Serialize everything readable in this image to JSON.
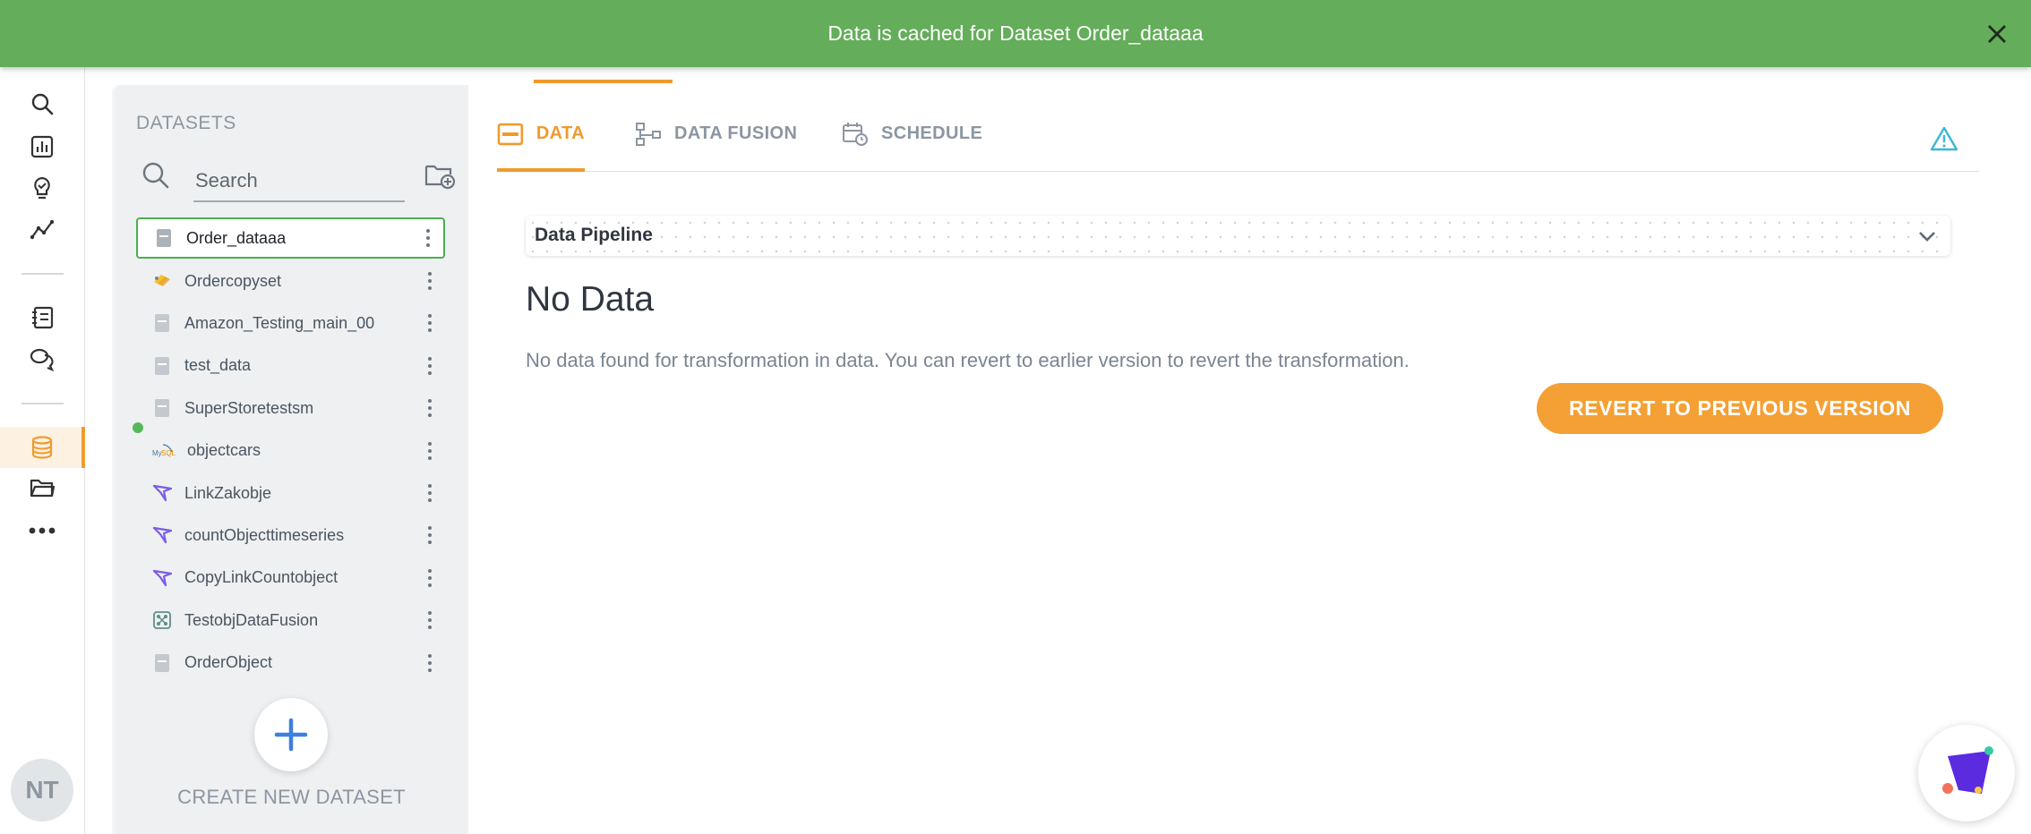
{
  "toast": {
    "message": "Data is cached for Dataset Order_dataaa",
    "color": "#64ad5a"
  },
  "nav": {
    "items": [
      "search-icon",
      "dashboard-icon",
      "insight-bulb-icon",
      "analytics-line-icon",
      "notebook-icon",
      "chat-icon",
      "database-icon",
      "folder-icon",
      "more-icon"
    ],
    "active": "database-icon",
    "avatar_initials": "NT"
  },
  "datasets": {
    "title": "DATASETS",
    "search_placeholder": "Search",
    "items": [
      {
        "label": "Order_dataaa",
        "icon": "file-icon",
        "selected": true
      },
      {
        "label": "Ordercopyset",
        "icon": "copy-set-icon"
      },
      {
        "label": "Amazon_Testing_main_00",
        "icon": "file-icon"
      },
      {
        "label": "test_data",
        "icon": "file-icon"
      },
      {
        "label": "SuperStoretestsm",
        "icon": "file-icon"
      },
      {
        "label": "objectcars",
        "icon": "mysql-icon",
        "status": "online"
      },
      {
        "label": "LinkZakobje",
        "icon": "object-link-icon"
      },
      {
        "label": "countObjecttimeseries",
        "icon": "object-link-icon"
      },
      {
        "label": "CopyLinkCountobject",
        "icon": "object-link-icon"
      },
      {
        "label": "TestobjDataFusion",
        "icon": "data-fusion-icon"
      },
      {
        "label": "OrderObject",
        "icon": "file-icon"
      }
    ],
    "create_label": "CREATE NEW DATASET"
  },
  "tabs": [
    {
      "label": "DATA",
      "icon": "data-table-icon",
      "active": true
    },
    {
      "label": "DATA FUSION",
      "icon": "fusion-flow-icon"
    },
    {
      "label": "SCHEDULE",
      "icon": "calendar-clock-icon"
    }
  ],
  "pipeline": {
    "label": "Data Pipeline"
  },
  "empty_state": {
    "title": "No Data",
    "message": "No data found for transformation in data. You can revert to earlier version to revert the transformation.",
    "revert_label": "REVERT TO PREVIOUS VERSION"
  },
  "colors": {
    "accent": "#f09a2e",
    "selected_border": "#4caf50",
    "toast": "#64ad5a"
  }
}
